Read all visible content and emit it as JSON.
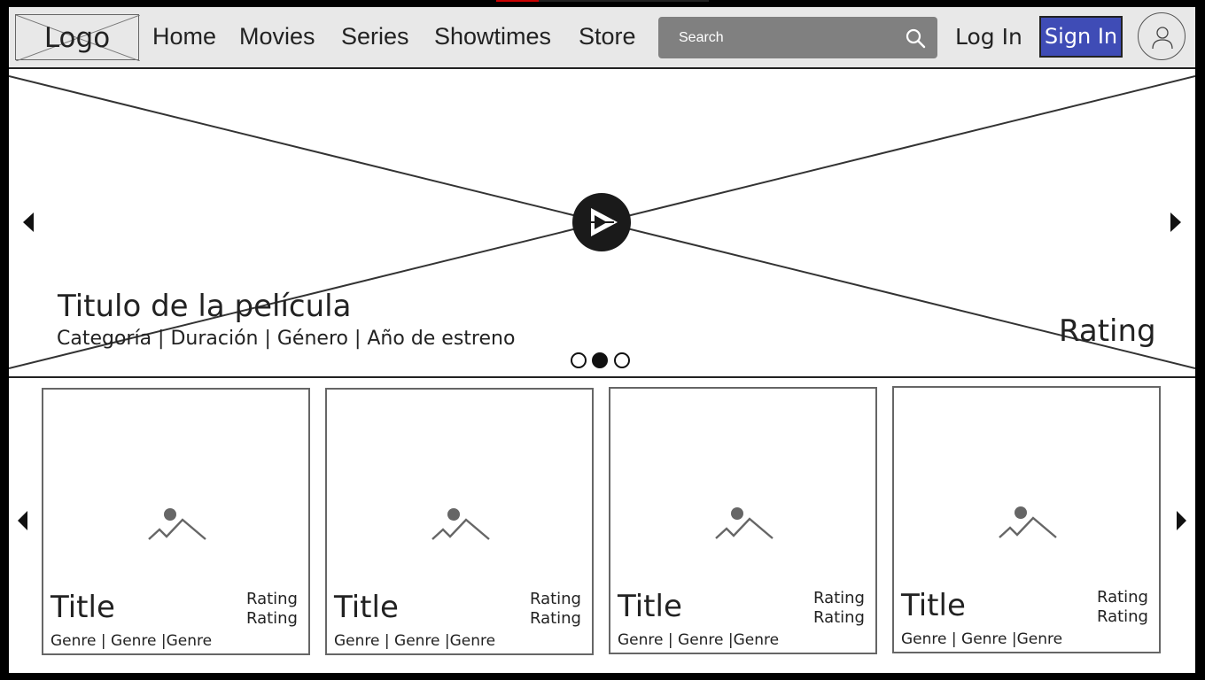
{
  "navbar": {
    "logo": "Logo",
    "links": [
      "Home",
      "Movies",
      "Series",
      "Showtimes",
      "Store"
    ],
    "search": {
      "placeholder": "Search",
      "icon": "search-icon"
    },
    "login": "Log In",
    "signin": "Sign In",
    "avatar_icon": "user-icon"
  },
  "hero": {
    "title": "Titulo de la película",
    "meta": "Categoría | Duración | Género | Año de estreno",
    "rating": "Rating",
    "slides": 3,
    "active_slide": 2,
    "play_icon": "play-icon",
    "prev_icon": "chevron-left-icon",
    "next_icon": "chevron-right-icon"
  },
  "cards": [
    {
      "title": "Title",
      "rating1": "Rating",
      "rating2": "Rating",
      "genre": "Genre | Genre |Genre"
    },
    {
      "title": "Title",
      "rating1": "Rating",
      "rating2": "Rating",
      "genre": "Genre | Genre |Genre"
    },
    {
      "title": "Title",
      "rating1": "Rating",
      "rating2": "Rating",
      "genre": "Genre | Genre |Genre"
    },
    {
      "title": "Title",
      "rating1": "Rating",
      "rating2": "Rating",
      "genre": "Genre | Genre |Genre"
    }
  ],
  "colors": {
    "signin_bg": "#3f4cb6",
    "search_bg": "#808080",
    "navbar_bg": "#e8e8e8"
  }
}
